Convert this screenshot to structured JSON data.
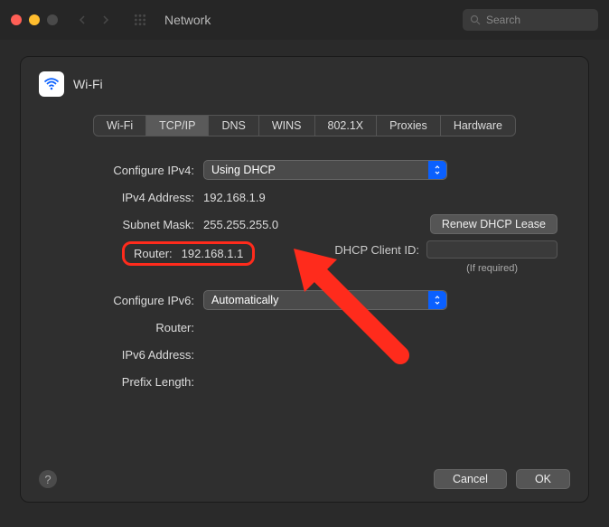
{
  "window": {
    "title": "Network",
    "search_placeholder": "Search"
  },
  "panel": {
    "title": "Wi-Fi"
  },
  "tabs": [
    "Wi-Fi",
    "TCP/IP",
    "DNS",
    "WINS",
    "802.1X",
    "Proxies",
    "Hardware"
  ],
  "active_tab": "TCP/IP",
  "ipv4": {
    "configure_label": "Configure IPv4:",
    "configure_value": "Using DHCP",
    "address_label": "IPv4 Address:",
    "address_value": "192.168.1.9",
    "subnet_label": "Subnet Mask:",
    "subnet_value": "255.255.255.0",
    "router_label": "Router:",
    "router_value": "192.168.1.1",
    "renew_label": "Renew DHCP Lease",
    "dhcp_client_label": "DHCP Client ID:",
    "dhcp_client_hint": "(If required)"
  },
  "ipv6": {
    "configure_label": "Configure IPv6:",
    "configure_value": "Automatically",
    "router_label": "Router:",
    "address_label": "IPv6 Address:",
    "prefix_label": "Prefix Length:"
  },
  "footer": {
    "help": "?",
    "cancel": "Cancel",
    "ok": "OK"
  },
  "colors": {
    "highlight": "#ff2b1c",
    "accent": "#0a60ff"
  }
}
